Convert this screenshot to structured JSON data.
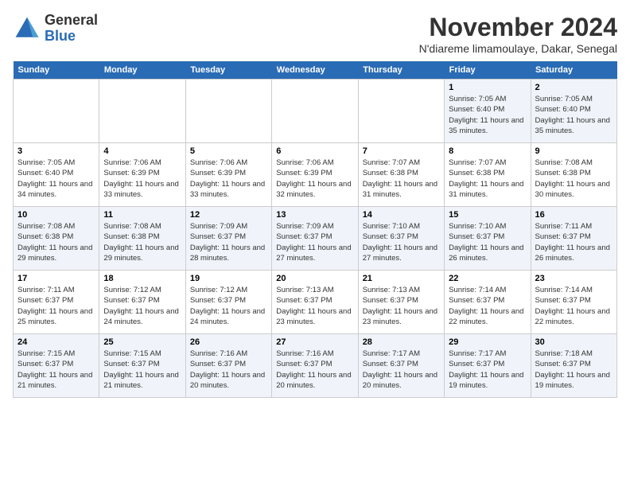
{
  "logo": {
    "line1": "General",
    "line2": "Blue"
  },
  "title": "November 2024",
  "subtitle": "N'diareme limamoulaye, Dakar, Senegal",
  "weekdays": [
    "Sunday",
    "Monday",
    "Tuesday",
    "Wednesday",
    "Thursday",
    "Friday",
    "Saturday"
  ],
  "weeks": [
    [
      {
        "day": "",
        "info": ""
      },
      {
        "day": "",
        "info": ""
      },
      {
        "day": "",
        "info": ""
      },
      {
        "day": "",
        "info": ""
      },
      {
        "day": "",
        "info": ""
      },
      {
        "day": "1",
        "info": "Sunrise: 7:05 AM\nSunset: 6:40 PM\nDaylight: 11 hours and 35 minutes."
      },
      {
        "day": "2",
        "info": "Sunrise: 7:05 AM\nSunset: 6:40 PM\nDaylight: 11 hours and 35 minutes."
      }
    ],
    [
      {
        "day": "3",
        "info": "Sunrise: 7:05 AM\nSunset: 6:40 PM\nDaylight: 11 hours and 34 minutes."
      },
      {
        "day": "4",
        "info": "Sunrise: 7:06 AM\nSunset: 6:39 PM\nDaylight: 11 hours and 33 minutes."
      },
      {
        "day": "5",
        "info": "Sunrise: 7:06 AM\nSunset: 6:39 PM\nDaylight: 11 hours and 33 minutes."
      },
      {
        "day": "6",
        "info": "Sunrise: 7:06 AM\nSunset: 6:39 PM\nDaylight: 11 hours and 32 minutes."
      },
      {
        "day": "7",
        "info": "Sunrise: 7:07 AM\nSunset: 6:38 PM\nDaylight: 11 hours and 31 minutes."
      },
      {
        "day": "8",
        "info": "Sunrise: 7:07 AM\nSunset: 6:38 PM\nDaylight: 11 hours and 31 minutes."
      },
      {
        "day": "9",
        "info": "Sunrise: 7:08 AM\nSunset: 6:38 PM\nDaylight: 11 hours and 30 minutes."
      }
    ],
    [
      {
        "day": "10",
        "info": "Sunrise: 7:08 AM\nSunset: 6:38 PM\nDaylight: 11 hours and 29 minutes."
      },
      {
        "day": "11",
        "info": "Sunrise: 7:08 AM\nSunset: 6:38 PM\nDaylight: 11 hours and 29 minutes."
      },
      {
        "day": "12",
        "info": "Sunrise: 7:09 AM\nSunset: 6:37 PM\nDaylight: 11 hours and 28 minutes."
      },
      {
        "day": "13",
        "info": "Sunrise: 7:09 AM\nSunset: 6:37 PM\nDaylight: 11 hours and 27 minutes."
      },
      {
        "day": "14",
        "info": "Sunrise: 7:10 AM\nSunset: 6:37 PM\nDaylight: 11 hours and 27 minutes."
      },
      {
        "day": "15",
        "info": "Sunrise: 7:10 AM\nSunset: 6:37 PM\nDaylight: 11 hours and 26 minutes."
      },
      {
        "day": "16",
        "info": "Sunrise: 7:11 AM\nSunset: 6:37 PM\nDaylight: 11 hours and 26 minutes."
      }
    ],
    [
      {
        "day": "17",
        "info": "Sunrise: 7:11 AM\nSunset: 6:37 PM\nDaylight: 11 hours and 25 minutes."
      },
      {
        "day": "18",
        "info": "Sunrise: 7:12 AM\nSunset: 6:37 PM\nDaylight: 11 hours and 24 minutes."
      },
      {
        "day": "19",
        "info": "Sunrise: 7:12 AM\nSunset: 6:37 PM\nDaylight: 11 hours and 24 minutes."
      },
      {
        "day": "20",
        "info": "Sunrise: 7:13 AM\nSunset: 6:37 PM\nDaylight: 11 hours and 23 minutes."
      },
      {
        "day": "21",
        "info": "Sunrise: 7:13 AM\nSunset: 6:37 PM\nDaylight: 11 hours and 23 minutes."
      },
      {
        "day": "22",
        "info": "Sunrise: 7:14 AM\nSunset: 6:37 PM\nDaylight: 11 hours and 22 minutes."
      },
      {
        "day": "23",
        "info": "Sunrise: 7:14 AM\nSunset: 6:37 PM\nDaylight: 11 hours and 22 minutes."
      }
    ],
    [
      {
        "day": "24",
        "info": "Sunrise: 7:15 AM\nSunset: 6:37 PM\nDaylight: 11 hours and 21 minutes."
      },
      {
        "day": "25",
        "info": "Sunrise: 7:15 AM\nSunset: 6:37 PM\nDaylight: 11 hours and 21 minutes."
      },
      {
        "day": "26",
        "info": "Sunrise: 7:16 AM\nSunset: 6:37 PM\nDaylight: 11 hours and 20 minutes."
      },
      {
        "day": "27",
        "info": "Sunrise: 7:16 AM\nSunset: 6:37 PM\nDaylight: 11 hours and 20 minutes."
      },
      {
        "day": "28",
        "info": "Sunrise: 7:17 AM\nSunset: 6:37 PM\nDaylight: 11 hours and 20 minutes."
      },
      {
        "day": "29",
        "info": "Sunrise: 7:17 AM\nSunset: 6:37 PM\nDaylight: 11 hours and 19 minutes."
      },
      {
        "day": "30",
        "info": "Sunrise: 7:18 AM\nSunset: 6:37 PM\nDaylight: 11 hours and 19 minutes."
      }
    ]
  ]
}
